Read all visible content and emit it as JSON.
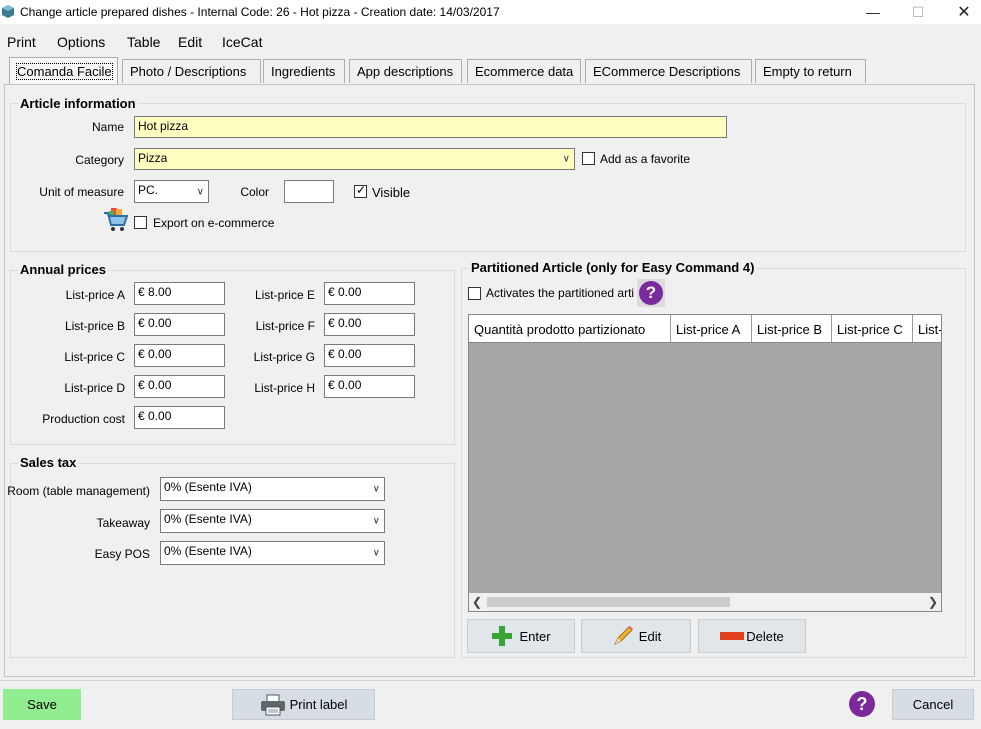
{
  "window": {
    "title": "Change article prepared dishes - Internal Code: 26 - Hot pizza - Creation date: 14/03/2017",
    "minimize": "—",
    "maximize": "☐",
    "close": "✕"
  },
  "menu": [
    "Print",
    "Options",
    "Table",
    "Edit",
    "IceCat"
  ],
  "tabs": [
    "Comanda Facile",
    "Photo / Descriptions",
    "Ingredients",
    "App descriptions",
    "Ecommerce data",
    "ECommerce Descriptions",
    "Empty to return"
  ],
  "article_info": {
    "title": "Article information",
    "name_label": "Name",
    "name_value": "Hot pizza",
    "category_label": "Category",
    "category_value": "Pizza",
    "favorite_label": "Add as a favorite",
    "unit_label": "Unit of measure",
    "unit_value": "PC.",
    "color_label": "Color",
    "visible_label": "Visible",
    "export_label": "Export on e-commerce"
  },
  "annual_prices": {
    "title": "Annual prices",
    "prices": [
      {
        "label": "List-price A",
        "value": "€ 8.00"
      },
      {
        "label": "List-price B",
        "value": "€ 0.00"
      },
      {
        "label": "List-price C",
        "value": "€ 0.00"
      },
      {
        "label": "List-price D",
        "value": "€ 0.00"
      },
      {
        "label": "Production cost",
        "value": "€ 0.00"
      },
      {
        "label": "List-price E",
        "value": "€ 0.00"
      },
      {
        "label": "List-price F",
        "value": "€ 0.00"
      },
      {
        "label": "List-price G",
        "value": "€ 0.00"
      },
      {
        "label": "List-price H",
        "value": "€ 0.00"
      }
    ]
  },
  "sales_tax": {
    "title": "Sales tax",
    "rows": [
      {
        "label": "Room (table management)",
        "value": "0% (Esente IVA)"
      },
      {
        "label": "Takeaway",
        "value": "0% (Esente IVA)"
      },
      {
        "label": "Easy POS",
        "value": "0% (Esente IVA)"
      }
    ]
  },
  "partitioned": {
    "title": "Partitioned Article (only for Easy Command 4)",
    "activate_label": "Activates the partitioned arti",
    "help": "?",
    "columns": [
      "Quantità prodotto partizionato",
      "List-price A",
      "List-price B",
      "List-price C",
      "List-"
    ],
    "enter_label": "Enter",
    "edit_label": "Edit",
    "delete_label": "Delete"
  },
  "footer": {
    "save_label": "Save",
    "print_label": "Print label",
    "help": "?",
    "cancel_label": "Cancel"
  },
  "colors": {
    "save_button": "#90ee90",
    "yellow_field": "#ffffc2",
    "help_purple": "#7b2a9c"
  }
}
